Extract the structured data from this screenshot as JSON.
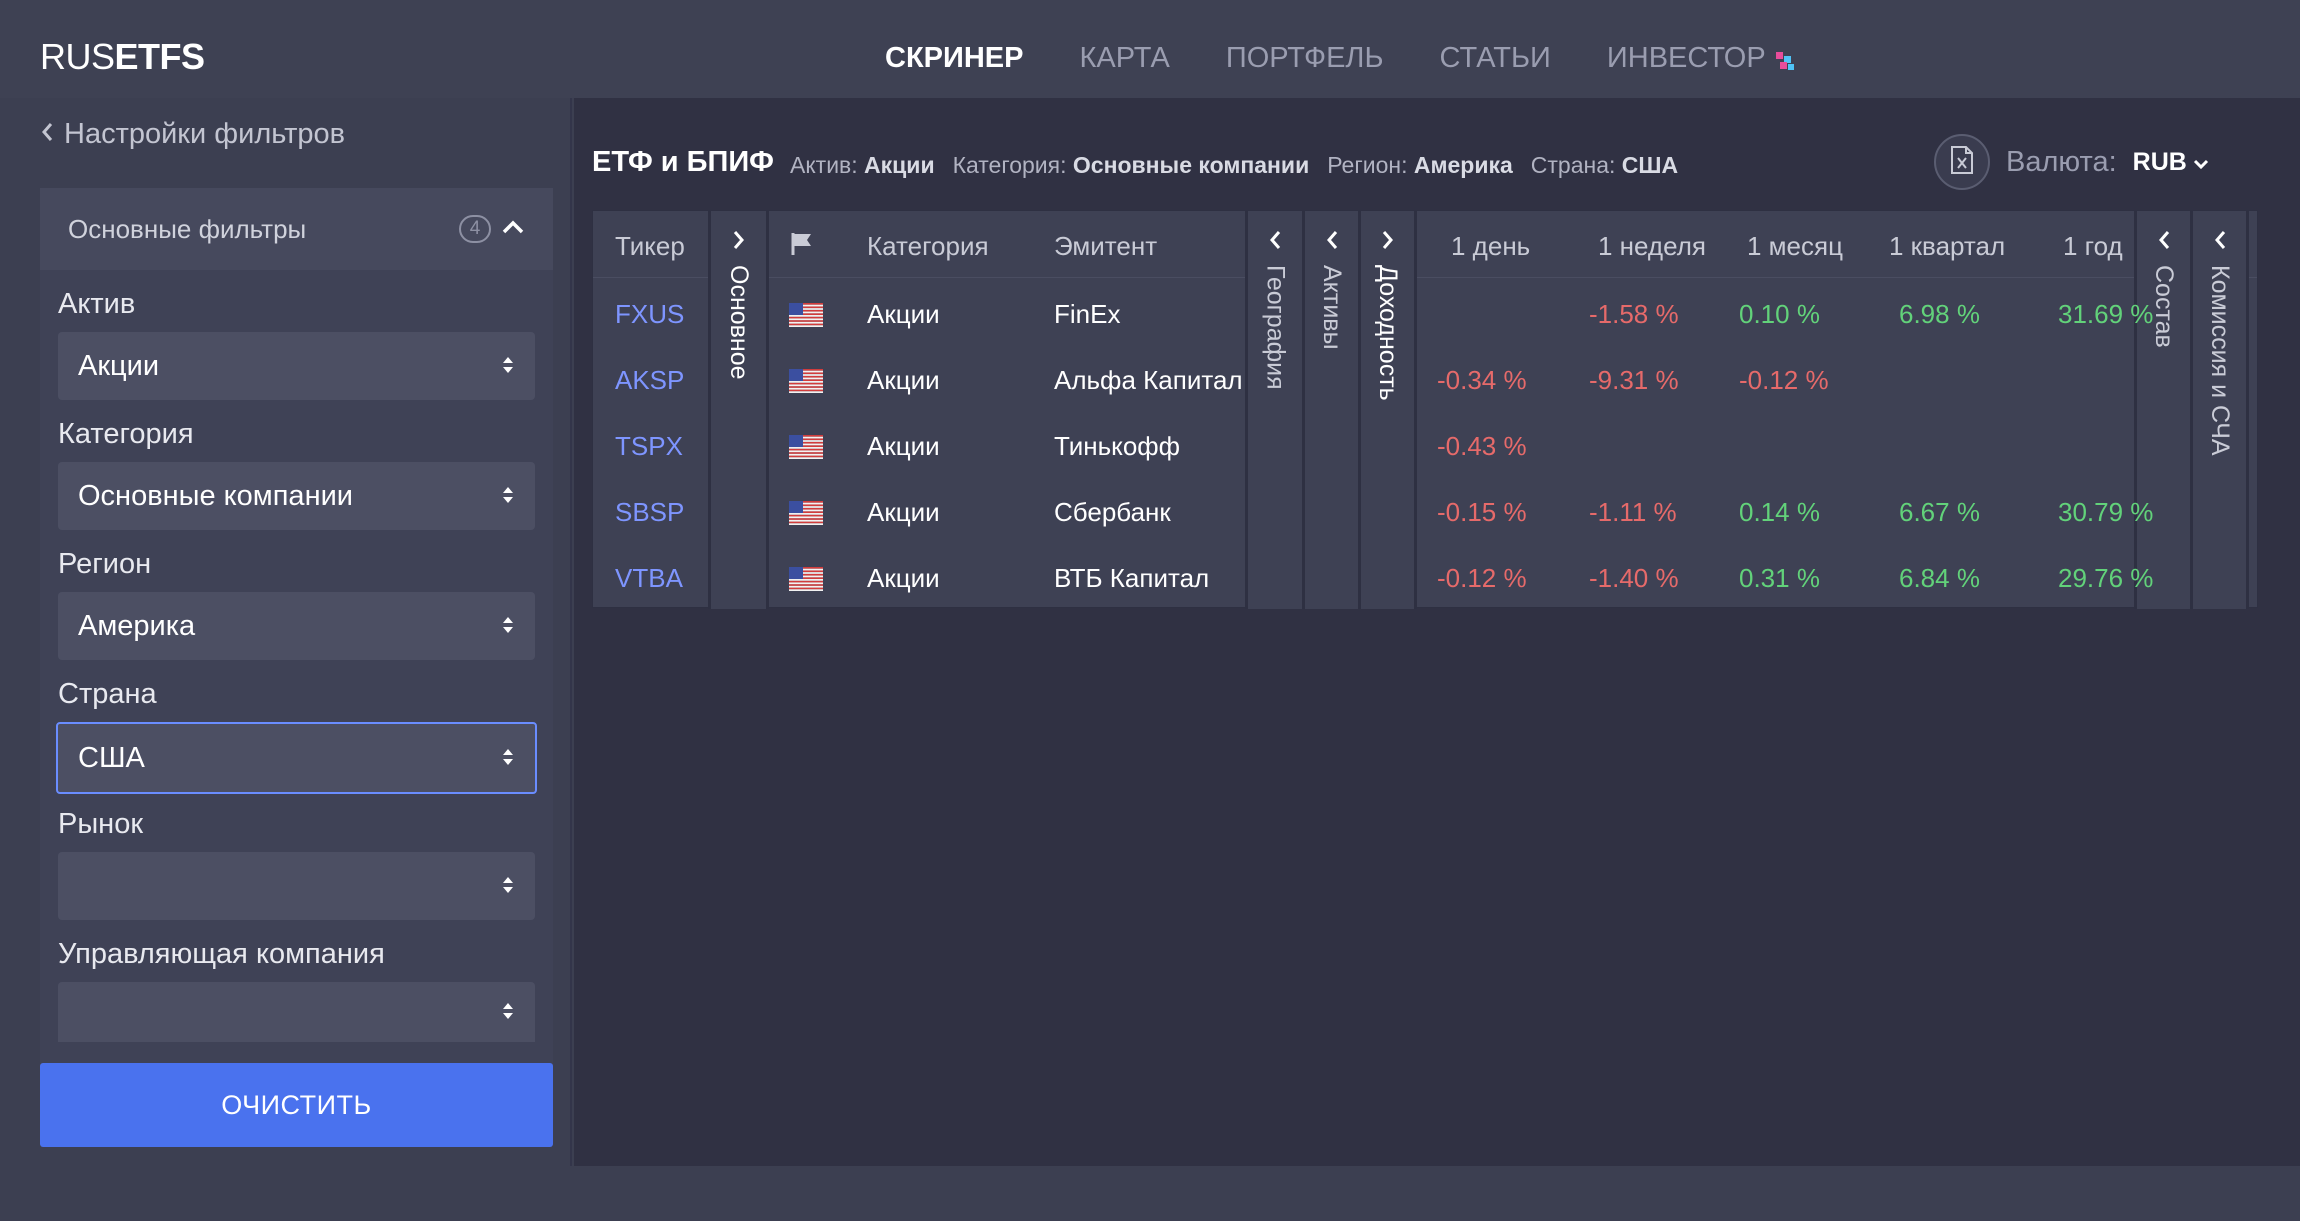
{
  "header": {
    "logo_light": "RUS",
    "logo_bold": "ETFS",
    "nav": [
      {
        "label": "СКРИНЕР",
        "active": true
      },
      {
        "label": "КАРТА",
        "active": false
      },
      {
        "label": "ПОРТФЕЛЬ",
        "active": false
      },
      {
        "label": "СТАТЬИ",
        "active": false
      },
      {
        "label": "ИНВЕСТОР",
        "active": false
      }
    ]
  },
  "sidebar": {
    "back_label": "Настройки фильтров",
    "panel_title": "Основные фильтры",
    "panel_count": "4",
    "fields": [
      {
        "label": "Актив",
        "value": "Акции"
      },
      {
        "label": "Категория",
        "value": "Основные компании"
      },
      {
        "label": "Регион",
        "value": "Америка"
      },
      {
        "label": "Страна",
        "value": "США"
      },
      {
        "label": "Рынок",
        "value": ""
      },
      {
        "label": "Управляющая компания",
        "value": ""
      }
    ],
    "clear_label": "ОЧИСТИТЬ"
  },
  "main": {
    "title": "ЕТФ и БПИФ",
    "crumbs": [
      {
        "key": "Актив:",
        "value": "Акции"
      },
      {
        "key": "Категория:",
        "value": "Основные компании"
      },
      {
        "key": "Регион:",
        "value": "Америка"
      },
      {
        "key": "Страна:",
        "value": "США"
      }
    ],
    "currency_label": "Валюта:",
    "currency_value": "RUB"
  },
  "table": {
    "headers": {
      "ticker": "Тикер",
      "category": "Категория",
      "issuer": "Эмитент",
      "d1": "1 день",
      "w1": "1 неделя",
      "m1": "1 месяц",
      "q1": "1 квартал",
      "y1": "1 год"
    },
    "groups": {
      "main": "Основное",
      "geography": "География",
      "assets": "Активы",
      "returns": "Доходность",
      "composition": "Состав",
      "fees": "Комиссия и СЧА"
    },
    "rows": [
      {
        "ticker": "FXUS",
        "category": "Акции",
        "issuer": "FinEx",
        "d1": "",
        "w1": "-1.58 %",
        "m1": "0.10 %",
        "q1": "6.98 %",
        "y1": "31.69 %"
      },
      {
        "ticker": "AKSP",
        "category": "Акции",
        "issuer": "Альфа Капитал",
        "d1": "-0.34 %",
        "w1": "-9.31 %",
        "m1": "-0.12 %",
        "q1": "",
        "y1": ""
      },
      {
        "ticker": "TSPX",
        "category": "Акции",
        "issuer": "Тинькофф",
        "d1": "-0.43 %",
        "w1": "",
        "m1": "",
        "q1": "",
        "y1": ""
      },
      {
        "ticker": "SBSP",
        "category": "Акции",
        "issuer": "Сбербанк",
        "d1": "-0.15 %",
        "w1": "-1.11 %",
        "m1": "0.14 %",
        "q1": "6.67 %",
        "y1": "30.79 %"
      },
      {
        "ticker": "VTBA",
        "category": "Акции",
        "issuer": "ВТБ Капитал",
        "d1": "-0.12 %",
        "w1": "-1.40 %",
        "m1": "0.31 %",
        "q1": "6.84 %",
        "y1": "29.76 %"
      }
    ]
  },
  "colors": {
    "accent": "#4a72ee",
    "ticker": "#7e95ff",
    "negative": "#e66a6a",
    "positive": "#62d27a"
  }
}
